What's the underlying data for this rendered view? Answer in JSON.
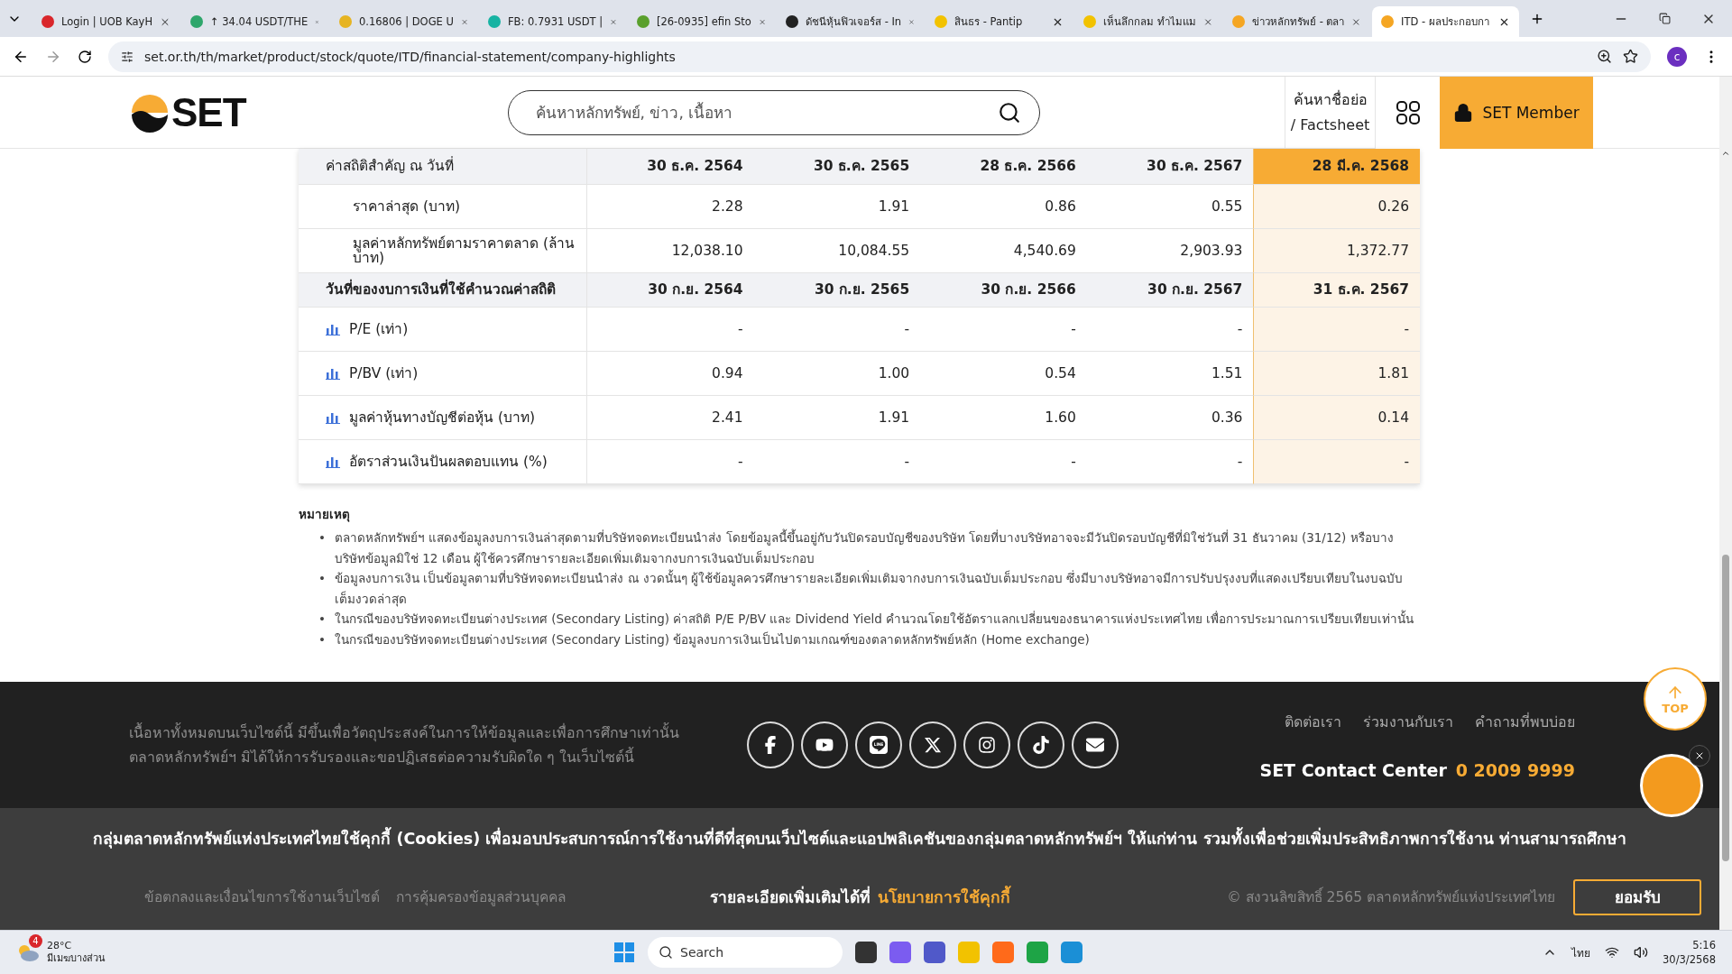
{
  "browser": {
    "tabs": [
      {
        "title": "Login | UOB KayH",
        "color": "#d9262b",
        "selected": false
      },
      {
        "title": "↑ 34.04 USDT/THE",
        "color": "#2ea66b",
        "selected": false
      },
      {
        "title": "0.16806 | DOGE U",
        "color": "#e6b422",
        "selected": false
      },
      {
        "title": "FB: 0.7931 USDT |",
        "color": "#17b3a3",
        "selected": false
      },
      {
        "title": "[26-0935] efin Sto",
        "color": "#5aa02c",
        "selected": false
      },
      {
        "title": "ดัชนีหุ้นฟิวเจอร์ส - In",
        "color": "#222222",
        "selected": false
      },
      {
        "title": "สินธร - Pantip",
        "color": "#f2c200",
        "selected": false
      },
      {
        "title": "เห็นลึกกลม ทำไมแม",
        "color": "#f2c200",
        "selected": false
      },
      {
        "title": "ข่าวหลักทรัพย์ - ตลา",
        "color": "#f5a623",
        "selected": false
      },
      {
        "title": "ITD - ผลประกอบกา",
        "color": "#f5a623",
        "selected": true
      }
    ],
    "url": "set.or.th/th/market/product/stock/quote/ITD/financial-statement/company-highlights",
    "profile": "c"
  },
  "header": {
    "logo": "SET",
    "search_placeholder": "ค้นหาหลักทรัพย์, ข่าว, เนื้อหา",
    "factsheet": [
      "ค้นหาชื่อย่อ",
      "/ Factsheet"
    ],
    "member": "SET Member"
  },
  "table": {
    "columns": [
      {
        "label": "ค่าสถิติสำคัญ ณ วันที่",
        "highlighted": false
      },
      {
        "label": "30 ธ.ค. 2564",
        "highlighted": false
      },
      {
        "label": "30 ธ.ค. 2565",
        "highlighted": false
      },
      {
        "label": "28 ธ.ค. 2566",
        "highlighted": false
      },
      {
        "label": "30 ธ.ค. 2567",
        "highlighted": false
      },
      {
        "label": "28 มี.ค. 2568",
        "highlighted": true
      }
    ],
    "rows": [
      {
        "kind": "data",
        "label": "ราคาล่าสุด (บาท)",
        "values": [
          "2.28",
          "1.91",
          "0.86",
          "0.55",
          "0.26"
        ]
      },
      {
        "kind": "data",
        "label": "มูลค่าหลักทรัพย์ตามราคาตลาด (ล้านบาท)",
        "values": [
          "12,038.10",
          "10,084.55",
          "4,540.69",
          "2,903.93",
          "1,372.77"
        ]
      },
      {
        "kind": "section",
        "label": "วันที่ของงบการเงินที่ใช้คำนวณค่าสถิติ",
        "values": [
          "30 ก.ย. 2564",
          "30 ก.ย. 2565",
          "30 ก.ย. 2566",
          "30 ก.ย. 2567",
          "31 ธ.ค. 2567"
        ]
      },
      {
        "kind": "chart",
        "label": "P/E (เท่า)",
        "values": [
          "-",
          "-",
          "-",
          "-",
          "-"
        ]
      },
      {
        "kind": "chart",
        "label": "P/BV (เท่า)",
        "values": [
          "0.94",
          "1.00",
          "0.54",
          "1.51",
          "1.81"
        ]
      },
      {
        "kind": "chart",
        "label": "มูลค่าหุ้นทางบัญชีต่อหุ้น (บาท)",
        "values": [
          "2.41",
          "1.91",
          "1.60",
          "0.36",
          "0.14"
        ]
      },
      {
        "kind": "chart",
        "label": "อัตราส่วนเงินปันผลตอบแทน (%)",
        "values": [
          "-",
          "-",
          "-",
          "-",
          "-"
        ]
      }
    ]
  },
  "notes": {
    "title": "หมายเหตุ",
    "marker": "•",
    "items": [
      "ตลาดหลักทรัพย์ฯ แสดงข้อมูลงบการเงินล่าสุดตามที่บริษัทจดทะเบียนนำส่ง โดยข้อมูลนี้ขึ้นอยู่กับวันปิดรอบบัญชีของบริษัท โดยที่บางบริษัทอาจจะมีวันปิดรอบบัญชีที่มิใช่วันที่ 31 ธันวาคม (31/12) หรือบางบริษัทข้อมูลมิใช่ 12 เดือน ผู้ใช้ควรศึกษารายละเอียดเพิ่มเติมจากงบการเงินฉบับเต็มประกอบ",
      "ข้อมูลงบการเงิน เป็นข้อมูลตามที่บริษัทจดทะเบียนนำส่ง ณ งวดนั้นๆ ผู้ใช้ข้อมูลควรศึกษารายละเอียดเพิ่มเติมจากงบการเงินฉบับเต็มประกอบ ซึ่งมีบางบริษัทอาจมีการปรับปรุงงบที่แสดงเปรียบเทียบในงบฉบับเต็มงวดล่าสุด",
      "ในกรณีของบริษัทจดทะเบียนต่างประเทศ (Secondary Listing) ค่าสถิติ P/E P/BV และ Dividend Yield คำนวณโดยใช้อัตราแลกเปลี่ยนของธนาคารแห่งประเทศไทย เพื่อการประมาณการเปรียบเทียบเท่านั้น",
      "ในกรณีของบริษัทจดทะเบียนต่างประเทศ (Secondary Listing) ข้อมูลงบการเงินเป็นไปตามเกณฑ์ของตลาดหลักทรัพย์หลัก (Home exchange)"
    ]
  },
  "footer": {
    "disclaimer": "เนื้อหาทั้งหมดบนเว็บไซต์นี้ มีขึ้นเพื่อวัตถุประสงค์ในการให้ข้อมูลและเพื่อการศึกษาเท่านั้น ตลาดหลักทรัพย์ฯ มิได้ให้การรับรองและขอปฏิเสธต่อความรับผิดใด ๆ ในเว็บไซต์นี้",
    "socials": [
      {
        "kind": "facebook"
      },
      {
        "kind": "youtube"
      },
      {
        "kind": "line"
      },
      {
        "kind": "x"
      },
      {
        "kind": "instagram"
      },
      {
        "kind": "tiktok"
      },
      {
        "kind": "mail"
      }
    ],
    "links": [
      "ติดต่อเรา",
      "ร่วมงานกับเรา",
      "คำถามที่พบบ่อย"
    ],
    "contact_label": "SET Contact Center",
    "phone": "0 2009 9999",
    "bottom_links": [
      "ข้อตกลงและเงื่อนไขการใช้งานเว็บไซต์",
      "การคุ้มครองข้อมูลส่วนบุคคล"
    ],
    "copyright": "© สงวนลิขสิทธิ์ 2565 ตลาดหลักทรัพย์แห่งประเทศไทย"
  },
  "cookie": {
    "message": "กลุ่มตลาดหลักทรัพย์แห่งประเทศไทยใช้คุกกี้ (Cookies) เพื่อมอบประสบการณ์การใช้งานที่ดีที่สุดบนเว็บไซต์และแอปพลิเคชันของกลุ่มตลาดหลักทรัพย์ฯ ให้แก่ท่าน รวมทั้งเพื่อช่วยเพิ่มประสิทธิภาพการใช้งาน ท่านสามารถศึกษา",
    "message_end": "รายละเอียดเพิ่มเติมได้ที่",
    "link": "นโยบายการใช้คุกกี้",
    "accept": "ยอมรับ"
  },
  "top_button": "TOP",
  "taskbar": {
    "badge": "4",
    "temperature": "28°C",
    "weather": "มีเมฆบางส่วน",
    "search": "Search",
    "language": "ไทย",
    "time": "5:16",
    "date": "30/3/2568"
  }
}
